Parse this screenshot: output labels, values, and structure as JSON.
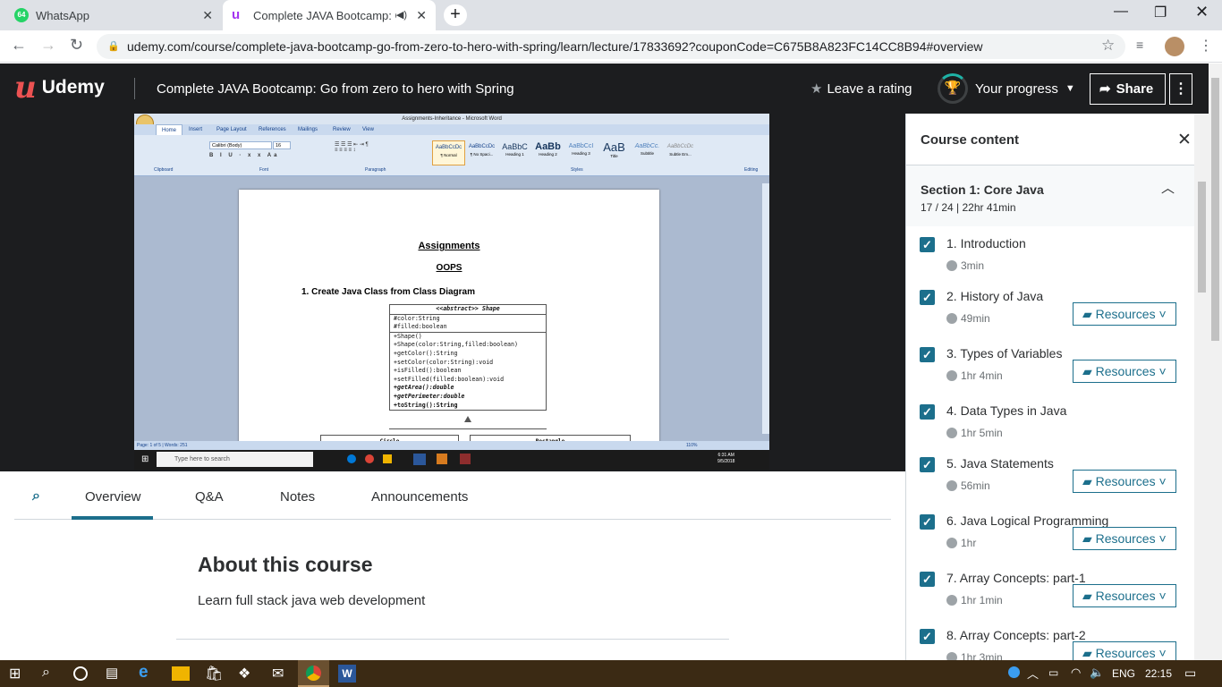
{
  "browser": {
    "tabs": [
      {
        "label": "WhatsApp",
        "badge": "64"
      },
      {
        "label": "Complete JAVA Bootcamp: G"
      }
    ],
    "url": "udemy.com/course/complete-java-bootcamp-go-from-zero-to-hero-with-spring/learn/lecture/17833692?couponCode=C675B8A823FC14CC8B94#overview"
  },
  "header": {
    "logo": "Udemy",
    "course_title": "Complete JAVA Bootcamp: Go from zero to hero with Spring",
    "rating_label": "Leave a rating",
    "progress_label": "Your progress",
    "share_label": "Share"
  },
  "video": {
    "word_title": "Assignments-Inheritance - Microsoft Word",
    "word_tabs": [
      "Home",
      "Insert",
      "Page Layout",
      "References",
      "Mailings",
      "Review",
      "View"
    ],
    "font_name": "Calibri (Body)",
    "font_size": "16",
    "styles": [
      {
        "sample": "AaBbCcDc",
        "name": "¶ Normal"
      },
      {
        "sample": "AaBbCcDc",
        "name": "¶ No Spaci..."
      },
      {
        "sample": "AaBbC",
        "name": "Heading 1"
      },
      {
        "sample": "AaBb",
        "name": "Heading 2"
      },
      {
        "sample": "AaBbCcI",
        "name": "Heading 3"
      },
      {
        "sample": "AaB",
        "name": "Title"
      },
      {
        "sample": "AaBbCc.",
        "name": "Subtitle"
      },
      {
        "sample": "AaBbCcDc",
        "name": "Subtle Em..."
      }
    ],
    "ribbon_groups": [
      "Clipboard",
      "Font",
      "Paragraph",
      "Styles",
      "Editing"
    ],
    "doc_heading": "Assignments",
    "doc_sub": "OOPS",
    "doc_item": "1.  Create Java Class from Class Diagram",
    "uml_title": "<<abstract>> Shape",
    "uml_fields": [
      "#color:String",
      "#filled:boolean"
    ],
    "uml_methods": [
      "+Shape()",
      "+Shape(color:String,filled:boolean)",
      "+getColor():String",
      "+setColor(color:String):void",
      "+isFilled():boolean",
      "+setFilled(filled:boolean):void",
      "+getArea():double",
      "+getPerimeter:double",
      "+toString():String"
    ],
    "uml_children": [
      "Circle",
      "Rectangle"
    ],
    "status_page": "Page: 1 of 5",
    "status_words": "Words: 251",
    "zoom": "110%",
    "inner_search": "Type here to search",
    "inner_time": "6:31 AM",
    "inner_date": "9/5/2018"
  },
  "lecture_tabs": [
    "Overview",
    "Q&A",
    "Notes",
    "Announcements"
  ],
  "about": {
    "heading": "About this course",
    "text": "Learn full stack java web development"
  },
  "sidebar": {
    "title": "Course content",
    "section_title": "Section 1: Core Java",
    "section_meta": "17 / 24 | 22hr 41min",
    "resources_label": "Resources",
    "items": [
      {
        "title": "1. Introduction",
        "duration": "3min",
        "resources": false
      },
      {
        "title": "2. History of Java",
        "duration": "49min",
        "resources": true
      },
      {
        "title": "3. Types of Variables",
        "duration": "1hr 4min",
        "resources": true
      },
      {
        "title": "4. Data Types in Java",
        "duration": "1hr 5min",
        "resources": false
      },
      {
        "title": "5. Java Statements",
        "duration": "56min",
        "resources": true
      },
      {
        "title": "6. Java Logical Programming",
        "duration": "1hr",
        "resources": true
      },
      {
        "title": "7. Array Concepts: part-1",
        "duration": "1hr 1min",
        "resources": true
      },
      {
        "title": "8. Array Concepts: part-2",
        "duration": "1hr 3min",
        "resources": true
      }
    ]
  },
  "taskbar": {
    "lang": "ENG",
    "time": "22:15"
  },
  "colors": {
    "header_bg": "#1c1d1f",
    "accent": "#1c6f8c",
    "logo_red": "#a435f0"
  }
}
